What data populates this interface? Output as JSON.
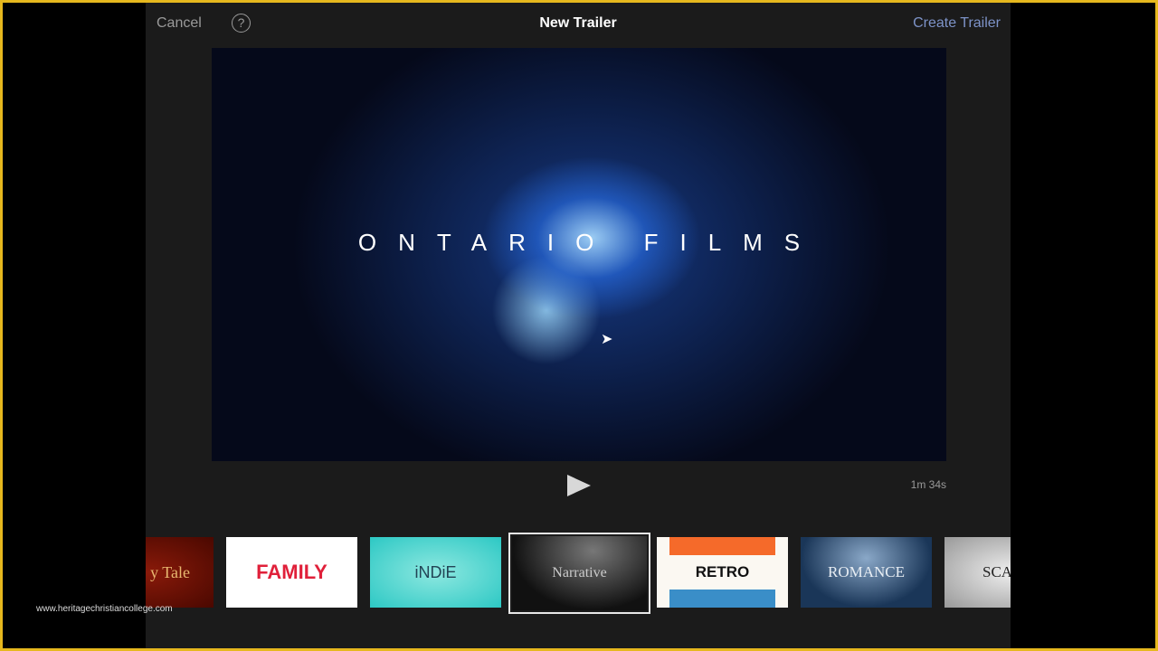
{
  "header": {
    "cancel": "Cancel",
    "help_icon": "?",
    "title": "New Trailer",
    "create": "Create Trailer"
  },
  "preview": {
    "title_text": "ONTARIO FILMS",
    "duration": "1m 34s"
  },
  "themes": [
    {
      "label": "Fairy Tale",
      "visible_label": "y Tale"
    },
    {
      "label": "FAMILY"
    },
    {
      "label": "iNDiE"
    },
    {
      "label": "Narrative",
      "selected": true
    },
    {
      "label": "RETRO"
    },
    {
      "label": "ROMANCE"
    },
    {
      "label": "Scary",
      "visible_label": "SCA"
    }
  ],
  "watermark": "www.heritagechristiancollege.com",
  "colors": {
    "accent": "#7d93c8",
    "frame": "#e6b81e",
    "background": "#1b1b1b"
  }
}
